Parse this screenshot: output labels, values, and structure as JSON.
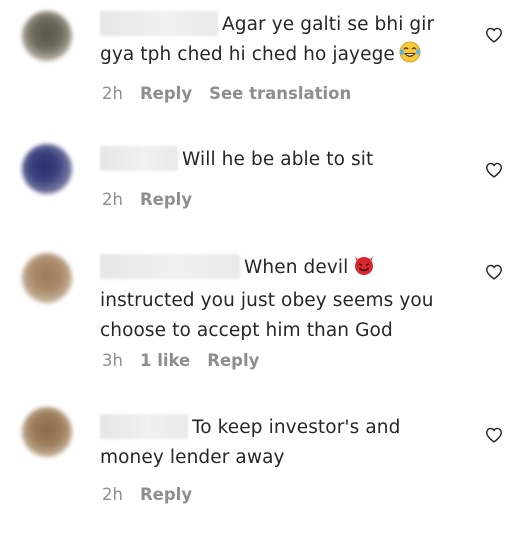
{
  "comments": [
    {
      "text": "Agar ye galti se bhi gir gya tph ched hi ched ho jayege",
      "emoji": "tears-of-joy-emoji",
      "time": "2h",
      "reply_label": "Reply",
      "translation_label": "See translation"
    },
    {
      "text": "Will he be able to sit",
      "time": "2h",
      "reply_label": "Reply"
    },
    {
      "text": "When devil",
      "text_line2": "instructed you just obey seems you choose to accept him than God",
      "emoji": "smiling-devil-emoji",
      "time": "3h",
      "likes": "1 like",
      "reply_label": "Reply"
    },
    {
      "text": "To keep investor's and money lender away",
      "time": "2h",
      "reply_label": "Reply"
    }
  ],
  "colors": {
    "text": "#262626",
    "meta": "#8e8e8e",
    "devil": "#d8262f"
  }
}
